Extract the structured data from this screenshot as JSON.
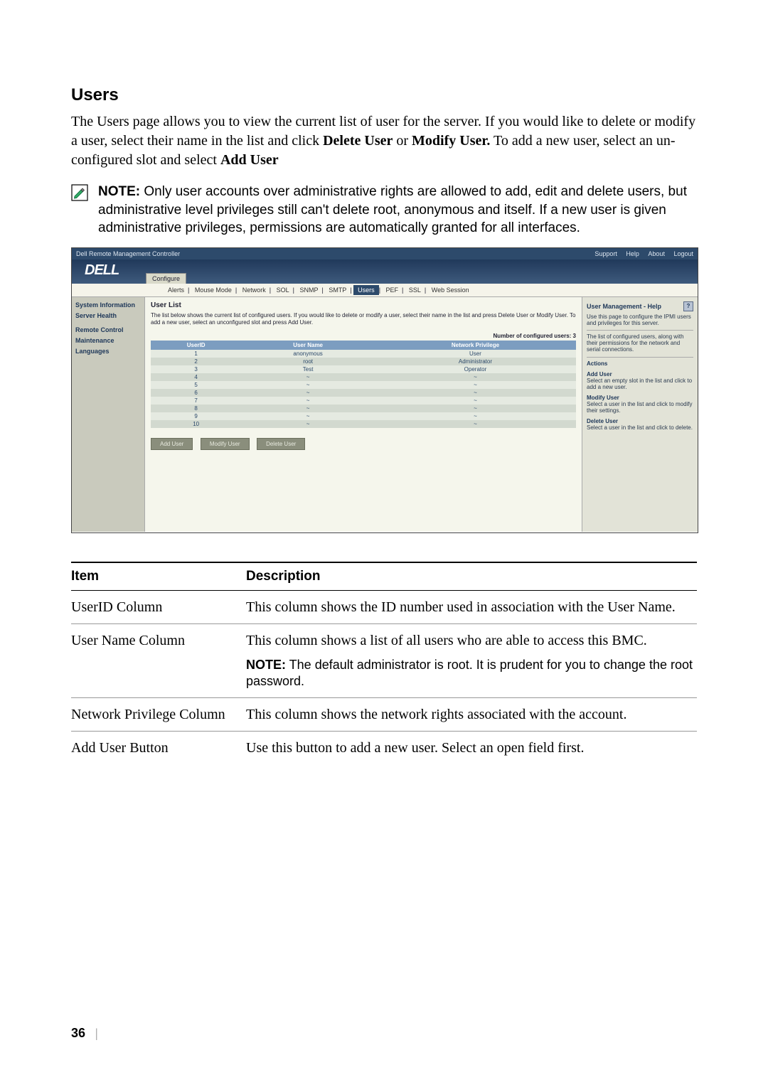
{
  "heading": "Users",
  "intro_html_parts": {
    "p1a": "The Users page allows you to view the current list of user for the server. If you would like to delete or modify a user, select their name in the list and click ",
    "b1": "Delete User",
    "p1b": " or ",
    "b2": "Modify User.",
    "p1c": " To add a new user, select an un-configured slot and select ",
    "b3": "Add User"
  },
  "note": {
    "label": "NOTE:",
    "text": " Only user accounts over administrative rights are allowed to add, edit and delete users, but administrative level privileges still can't delete root, anonymous and itself. If a new user is given administrative privileges, permissions are automatically granted for all interfaces."
  },
  "shot": {
    "window_title": "Dell Remote Management Controller",
    "top_links": [
      "Support",
      "Help",
      "About",
      "Logout"
    ],
    "logo": "DELL",
    "cfg_tab": "Configure",
    "subnav": [
      "Alerts",
      "Mouse Mode",
      "Network",
      "SOL",
      "SNMP",
      "SMTP",
      "Users",
      "PEF",
      "SSL",
      "Web Session"
    ],
    "subnav_active_index": 6,
    "sidebar": [
      "System Information",
      "Server Health",
      "Remote Control",
      "Maintenance",
      "Languages"
    ],
    "userlist_title": "User List",
    "userlist_desc": "The list below shows the current list of configured users. If you would like to delete or modify a user, select their name in the list and press Delete User or Modify User. To add a new user, select an unconfigured slot and press Add User.",
    "num_users_label": "Number of configured users: 3",
    "columns": [
      "UserID",
      "User Name",
      "Network Privilege"
    ],
    "rows": [
      {
        "id": "1",
        "name": "anonymous",
        "priv": "User"
      },
      {
        "id": "2",
        "name": "root",
        "priv": "Administrator"
      },
      {
        "id": "3",
        "name": "Test",
        "priv": "Operator"
      },
      {
        "id": "4",
        "name": "~",
        "priv": "~"
      },
      {
        "id": "5",
        "name": "~",
        "priv": "~"
      },
      {
        "id": "6",
        "name": "~",
        "priv": "~"
      },
      {
        "id": "7",
        "name": "~",
        "priv": "~"
      },
      {
        "id": "8",
        "name": "~",
        "priv": "~"
      },
      {
        "id": "9",
        "name": "~",
        "priv": "~"
      },
      {
        "id": "10",
        "name": "~",
        "priv": "~"
      }
    ],
    "buttons": [
      "Add User",
      "Modify User",
      "Delete User"
    ],
    "help": {
      "title": "User Management - Help",
      "intro": "Use this page to configure the IPMI users and privileges for this server.",
      "line2": "The list of configured users, along with their permissions for the network and serial connections.",
      "actions_label": "Actions",
      "blocks": [
        {
          "t": "Add User",
          "d": "Select an empty slot in the list and click to add a new user."
        },
        {
          "t": "Modify User",
          "d": "Select a user in the list and click to modify their settings."
        },
        {
          "t": "Delete User",
          "d": "Select a user in the list and click to delete."
        }
      ]
    }
  },
  "table": {
    "head": [
      "Item",
      "Description"
    ],
    "rows": [
      {
        "item": "UserID Column",
        "desc": "This column shows the ID number used in association with the User Name."
      },
      {
        "item": "User Name Column",
        "desc": "This column shows a list of all users who are able to access this BMC.",
        "note_label": "NOTE:",
        "note": " The default administrator is root. It is prudent for you to change the root password."
      },
      {
        "item": "Network Privilege Column",
        "desc": "This column shows the network rights associated with the account."
      },
      {
        "item": "Add User Button",
        "desc": "Use this button to add a new user. Select an open field first."
      }
    ]
  },
  "page_number": "36"
}
